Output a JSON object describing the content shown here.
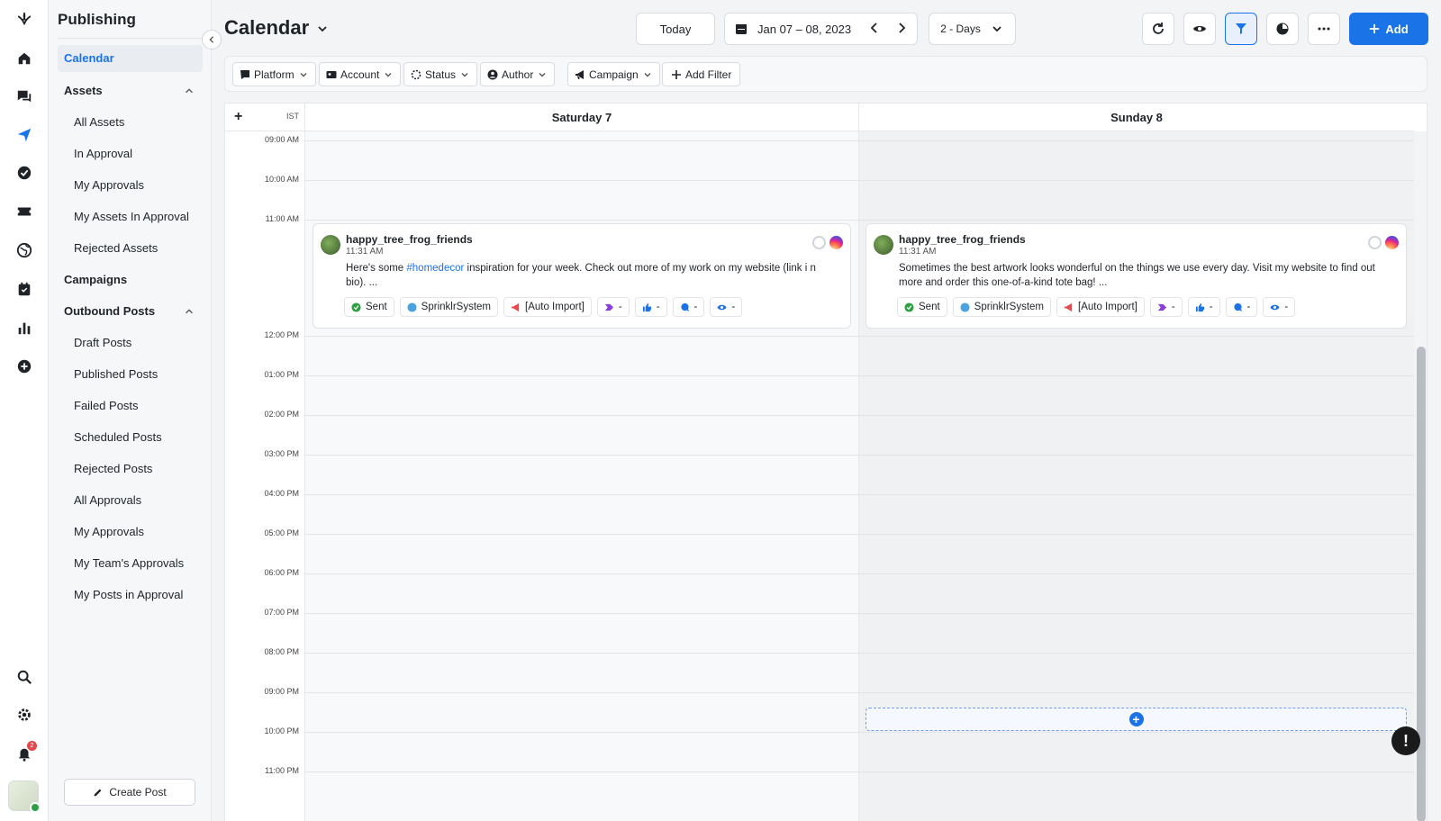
{
  "app": {
    "section_title": "Publishing",
    "notification_count": "2"
  },
  "rail": {
    "icons": [
      "sprinklr-logo-icon",
      "home-icon",
      "chat-icon",
      "send-icon",
      "check-circle-icon",
      "ticket-icon",
      "globe-icon",
      "calendar-check-icon",
      "bar-chart-icon",
      "add-circle-icon",
      "search-icon",
      "gear-icon",
      "bell-icon"
    ]
  },
  "sidebar": {
    "items": [
      {
        "label": "Calendar",
        "type": "active"
      },
      {
        "label": "Assets",
        "type": "section"
      },
      {
        "label": "All Assets",
        "type": "child"
      },
      {
        "label": "In Approval",
        "type": "child"
      },
      {
        "label": "My Approvals",
        "type": "child"
      },
      {
        "label": "My Assets In Approval",
        "type": "child"
      },
      {
        "label": "Rejected Assets",
        "type": "child"
      },
      {
        "label": "Campaigns",
        "type": "section"
      },
      {
        "label": "Outbound Posts",
        "type": "section"
      },
      {
        "label": "Draft Posts",
        "type": "child"
      },
      {
        "label": "Published Posts",
        "type": "child"
      },
      {
        "label": "Failed Posts",
        "type": "child"
      },
      {
        "label": "Scheduled Posts",
        "type": "child"
      },
      {
        "label": "Rejected Posts",
        "type": "child"
      },
      {
        "label": "All Approvals",
        "type": "child"
      },
      {
        "label": "My Approvals",
        "type": "child"
      },
      {
        "label": "My Team's Approvals",
        "type": "child"
      },
      {
        "label": "My Posts in Approval",
        "type": "child"
      }
    ],
    "create_post": "Create Post"
  },
  "header": {
    "title": "Calendar",
    "today": "Today",
    "date_range": "Jan 07 – 08, 2023",
    "view": "2 - Days",
    "add": "Add"
  },
  "filters": [
    "Platform",
    "Account",
    "Status",
    "Author",
    "Campaign",
    "Add Filter"
  ],
  "calendar": {
    "add_symbol": "+",
    "timezone": "IST",
    "days": [
      "Saturday 7",
      "Sunday 8"
    ],
    "times": [
      "09:00 AM",
      "10:00 AM",
      "11:00 AM",
      "12:00 PM",
      "01:00 PM",
      "02:00 PM",
      "03:00 PM",
      "04:00 PM",
      "05:00 PM",
      "06:00 PM",
      "07:00 PM",
      "08:00 PM",
      "09:00 PM",
      "10:00 PM",
      "11:00 PM"
    ],
    "posts": [
      {
        "author": "happy_tree_frog_friends",
        "time": "11:31 AM",
        "text_before": "Here's some ",
        "hashtag": "#homedecor",
        "text_after": " inspiration for your week. Check out more of my work on my website (link i n bio). ...",
        "status": "Sent",
        "user": "SprinklrSystem",
        "campaign": "[Auto Import]",
        "metric_a": "-",
        "likes": "-",
        "comments": "-",
        "views": "-"
      },
      {
        "author": "happy_tree_frog_friends",
        "time": "11:31 AM",
        "text_before": "Sometimes the best artwork looks wonderful on the things we use every day. Visit my website to find out more and order this one-of-a-kind tote bag! ...",
        "hashtag": "",
        "text_after": "",
        "status": "Sent",
        "user": "SprinklrSystem",
        "campaign": "[Auto Import]",
        "metric_a": "-",
        "likes": "-",
        "comments": "-",
        "views": "-"
      }
    ]
  },
  "colors": {
    "accent": "#1b73e8",
    "sent": "#2ea043",
    "instagram": "#d62976"
  }
}
